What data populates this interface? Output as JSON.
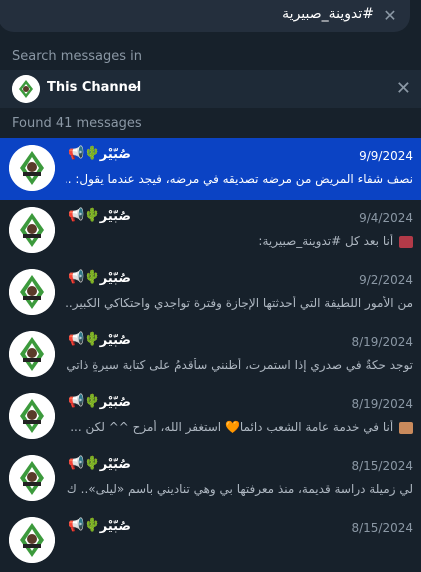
{
  "search": {
    "query": "#تدوينة_صبيرية"
  },
  "search_in_label": "Search messages in",
  "channel": {
    "name": "This Channel"
  },
  "found_label": "Found 41 messages",
  "results": [
    {
      "sender": "صُبّيْر",
      "date": "9/9/2024",
      "snippet": "نصف شفاء المريض من مرضه تصديقه في مرضه، فيجد عندما يقول: ..."
    },
    {
      "sender": "صُبّيْر",
      "date": "9/4/2024",
      "snippet": "أنا بعد كل #تدوينة_صبيرية:"
    },
    {
      "sender": "صُبّيْر",
      "date": "9/2/2024",
      "snippet": "من الأمور اللطيفة التي أحدثتها الإجازة وفترة تواجدي واحتكاكي الكبير..."
    },
    {
      "sender": "صُبّيْر",
      "date": "8/19/2024",
      "snippet": "توجد حكةٌ في صدري إذا استمرت، أظنني سأقدمُ على كتابة سيرةٍ ذاتي..."
    },
    {
      "sender": "صُبّيْر",
      "date": "8/19/2024",
      "snippet": "أنا في خدمة عامة الشعب دائما🧡 استغفر الله، أمزح ^^  لكن ..."
    },
    {
      "sender": "صُبّيْر",
      "date": "8/15/2024",
      "snippet": "لي زميلة دراسة قديمة، منذ معرفتها بي وهي تناديني باسم «ليلى».. ك..."
    },
    {
      "sender": "صُبّيْر",
      "date": "8/15/2024",
      "snippet": ""
    }
  ]
}
